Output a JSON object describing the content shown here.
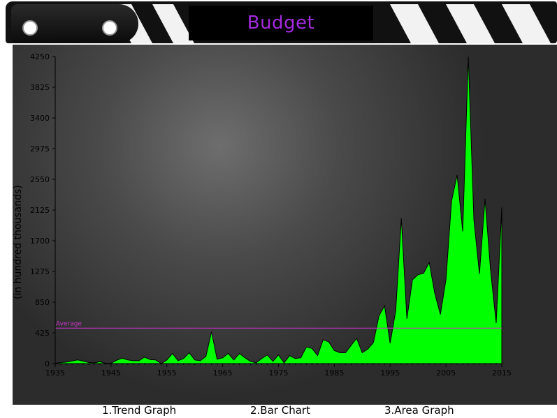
{
  "title": "Budget",
  "chart_data": {
    "type": "area",
    "ylabel": "(in hundred thousands)",
    "xlim": [
      1935,
      2015
    ],
    "ylim": [
      0,
      4250
    ],
    "yticks": [
      0,
      425,
      850,
      1275,
      1700,
      2125,
      2550,
      2975,
      3400,
      3825,
      4250
    ],
    "xticks": [
      1935,
      1945,
      1955,
      1965,
      1975,
      1985,
      1995,
      2005,
      2015
    ],
    "average_label": "Average",
    "average_value": 490,
    "fill_color": "#00ff00",
    "average_color": "#cc33cc",
    "x": [
      1935,
      1936,
      1937,
      1938,
      1939,
      1940,
      1941,
      1942,
      1943,
      1944,
      1945,
      1946,
      1947,
      1948,
      1949,
      1950,
      1951,
      1952,
      1953,
      1954,
      1955,
      1956,
      1957,
      1958,
      1959,
      1960,
      1961,
      1962,
      1963,
      1964,
      1965,
      1966,
      1967,
      1968,
      1969,
      1970,
      1971,
      1972,
      1973,
      1974,
      1975,
      1976,
      1977,
      1978,
      1979,
      1980,
      1981,
      1982,
      1983,
      1984,
      1985,
      1986,
      1987,
      1988,
      1989,
      1990,
      1991,
      1992,
      1993,
      1994,
      1995,
      1996,
      1997,
      1998,
      1999,
      2000,
      2001,
      2002,
      2003,
      2004,
      2005,
      2006,
      2007,
      2008,
      2009,
      2010,
      2011,
      2012,
      2013,
      2014,
      2015
    ],
    "y": [
      5,
      15,
      20,
      35,
      50,
      35,
      15,
      10,
      25,
      5,
      5,
      45,
      75,
      50,
      40,
      40,
      90,
      55,
      50,
      0,
      50,
      140,
      40,
      70,
      150,
      50,
      40,
      100,
      440,
      60,
      80,
      140,
      50,
      140,
      80,
      30,
      10,
      70,
      120,
      30,
      120,
      10,
      110,
      70,
      80,
      230,
      210,
      110,
      330,
      300,
      180,
      150,
      150,
      250,
      350,
      150,
      200,
      290,
      660,
      800,
      280,
      730,
      2010,
      620,
      1160,
      1230,
      1250,
      1400,
      970,
      680,
      1160,
      2250,
      2610,
      1830,
      4250,
      1990,
      1240,
      2280,
      1280,
      560,
      2160,
      0
    ]
  },
  "nav": {
    "trend": "1.Trend Graph",
    "bar": "2.Bar Chart",
    "area": "3.Area Graph"
  }
}
